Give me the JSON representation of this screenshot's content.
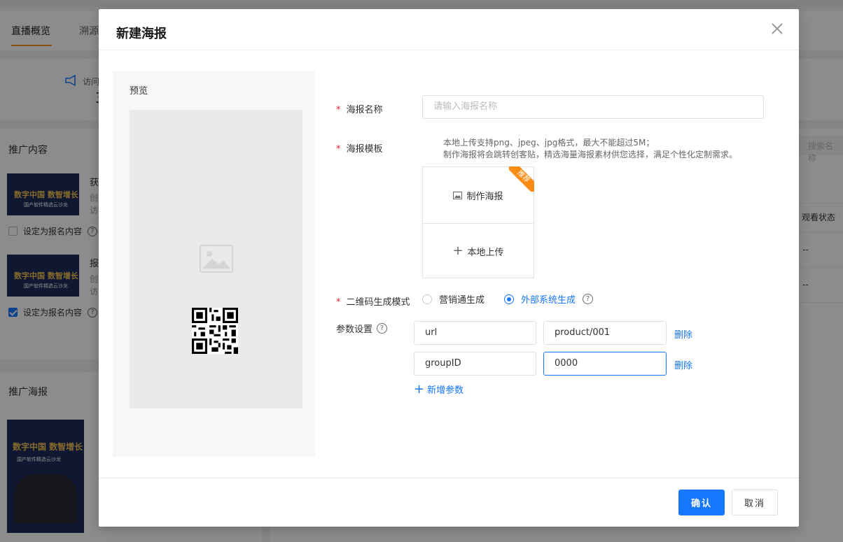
{
  "background": {
    "tabs": [
      {
        "label": "直播概览"
      },
      {
        "label": "溯源"
      }
    ],
    "stats_label": "访问",
    "stats_value": "3",
    "section_promo_content": "推广内容",
    "item1_title": "获",
    "item1_sub1": "创",
    "item1_sub2": "访",
    "item2_title": "报",
    "item2_sub1": "创",
    "item2_sub2": "访",
    "signup_label": "设定为报名内容",
    "section_promo_poster": "推广海报",
    "poster_title": "数字中国 数智增长",
    "poster_sub": "国产软件精选云沙龙",
    "thumb_title": "数字中国 数智增长",
    "thumb_sub": "国产软件精选云沙龙",
    "search_placeholder": "搜索名称",
    "col_status": "观看状态",
    "dash": "--"
  },
  "modal": {
    "title": "新建海报",
    "preview_label": "预览",
    "poster_name": {
      "label": "海报名称",
      "placeholder": "请输入海报名称",
      "value": ""
    },
    "poster_template": {
      "label": "海报模板",
      "hint_line1": "本地上传支持png、jpeg、jpg格式，最大不能超过5M；",
      "hint_line2": "制作海报将会跳转创客贴，精选海量海报素材供您选择，满足个性化定制需求。",
      "make_label": "制作海报",
      "ribbon_label": "推荐",
      "upload_label": "本地上传"
    },
    "qr_mode": {
      "label": "二维码生成模式",
      "options": [
        {
          "label": "营销通生成",
          "selected": false
        },
        {
          "label": "外部系统生成",
          "selected": true
        }
      ]
    },
    "params": {
      "label": "参数设置",
      "rows": [
        {
          "key": "url",
          "value": "product/001",
          "delete_label": "删除"
        },
        {
          "key": "groupID",
          "value": "0000",
          "delete_label": "删除"
        }
      ],
      "add_label": "新增参数"
    },
    "footer": {
      "confirm_label": "确认",
      "cancel_label": "取消"
    },
    "colors": {
      "primary": "#1677ff",
      "required": "#f5222d",
      "ribbon": "#fa8c16"
    }
  }
}
